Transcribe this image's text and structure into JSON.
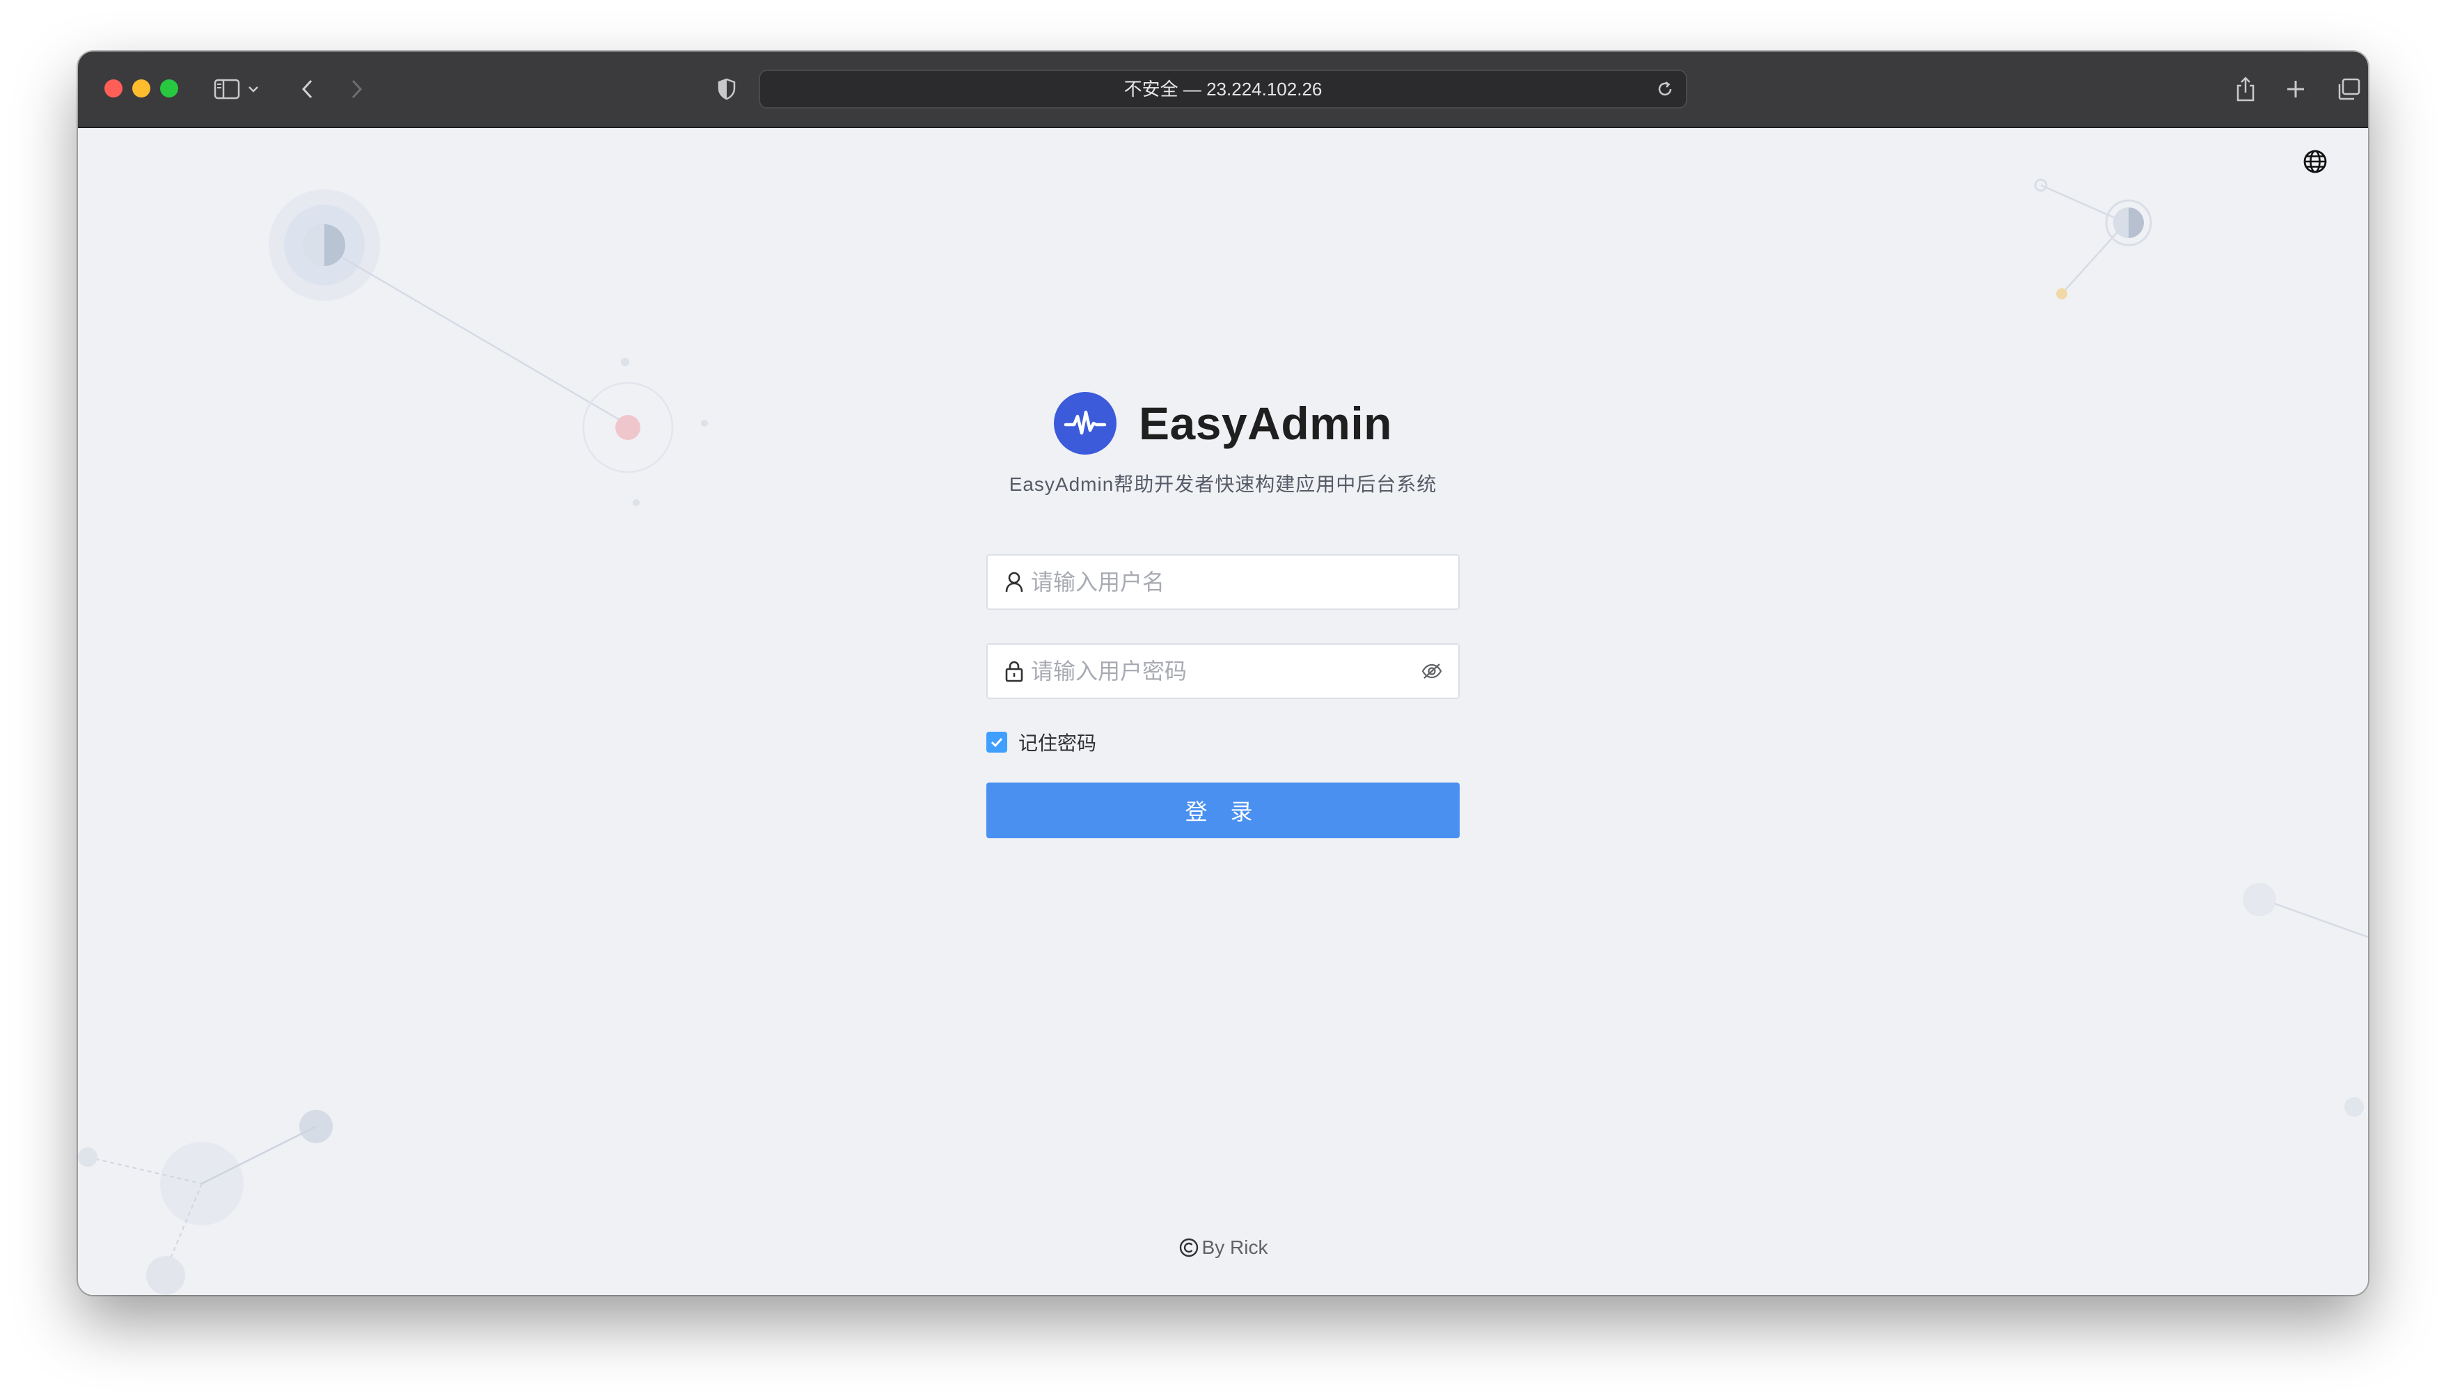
{
  "browser": {
    "address": "不安全 — 23.224.102.26",
    "toolbar_icons": [
      "sidebar-icon",
      "chevron-down-icon",
      "back-icon",
      "forward-icon",
      "shield-icon",
      "reload-icon",
      "share-icon",
      "new-tab-icon",
      "tabs-overview-icon"
    ]
  },
  "header": {
    "language_icon": "globe-icon"
  },
  "brand": {
    "name": "EasyAdmin",
    "subtitle": "EasyAdmin帮助开发者快速构建应用中后台系统",
    "logo_color": "#3b5bdb"
  },
  "login_form": {
    "username": {
      "placeholder": "请输入用户名",
      "value": "",
      "icon": "user-icon"
    },
    "password": {
      "placeholder": "请输入用户密码",
      "value": "",
      "icon": "lock-icon",
      "toggle_icon": "eye-off-icon"
    },
    "remember": {
      "label": "记住密码",
      "checked": true
    },
    "submit_label": "登 录",
    "button_color": "#4a90f0"
  },
  "footer": {
    "text": "By Rick",
    "icon": "copyright-icon"
  }
}
